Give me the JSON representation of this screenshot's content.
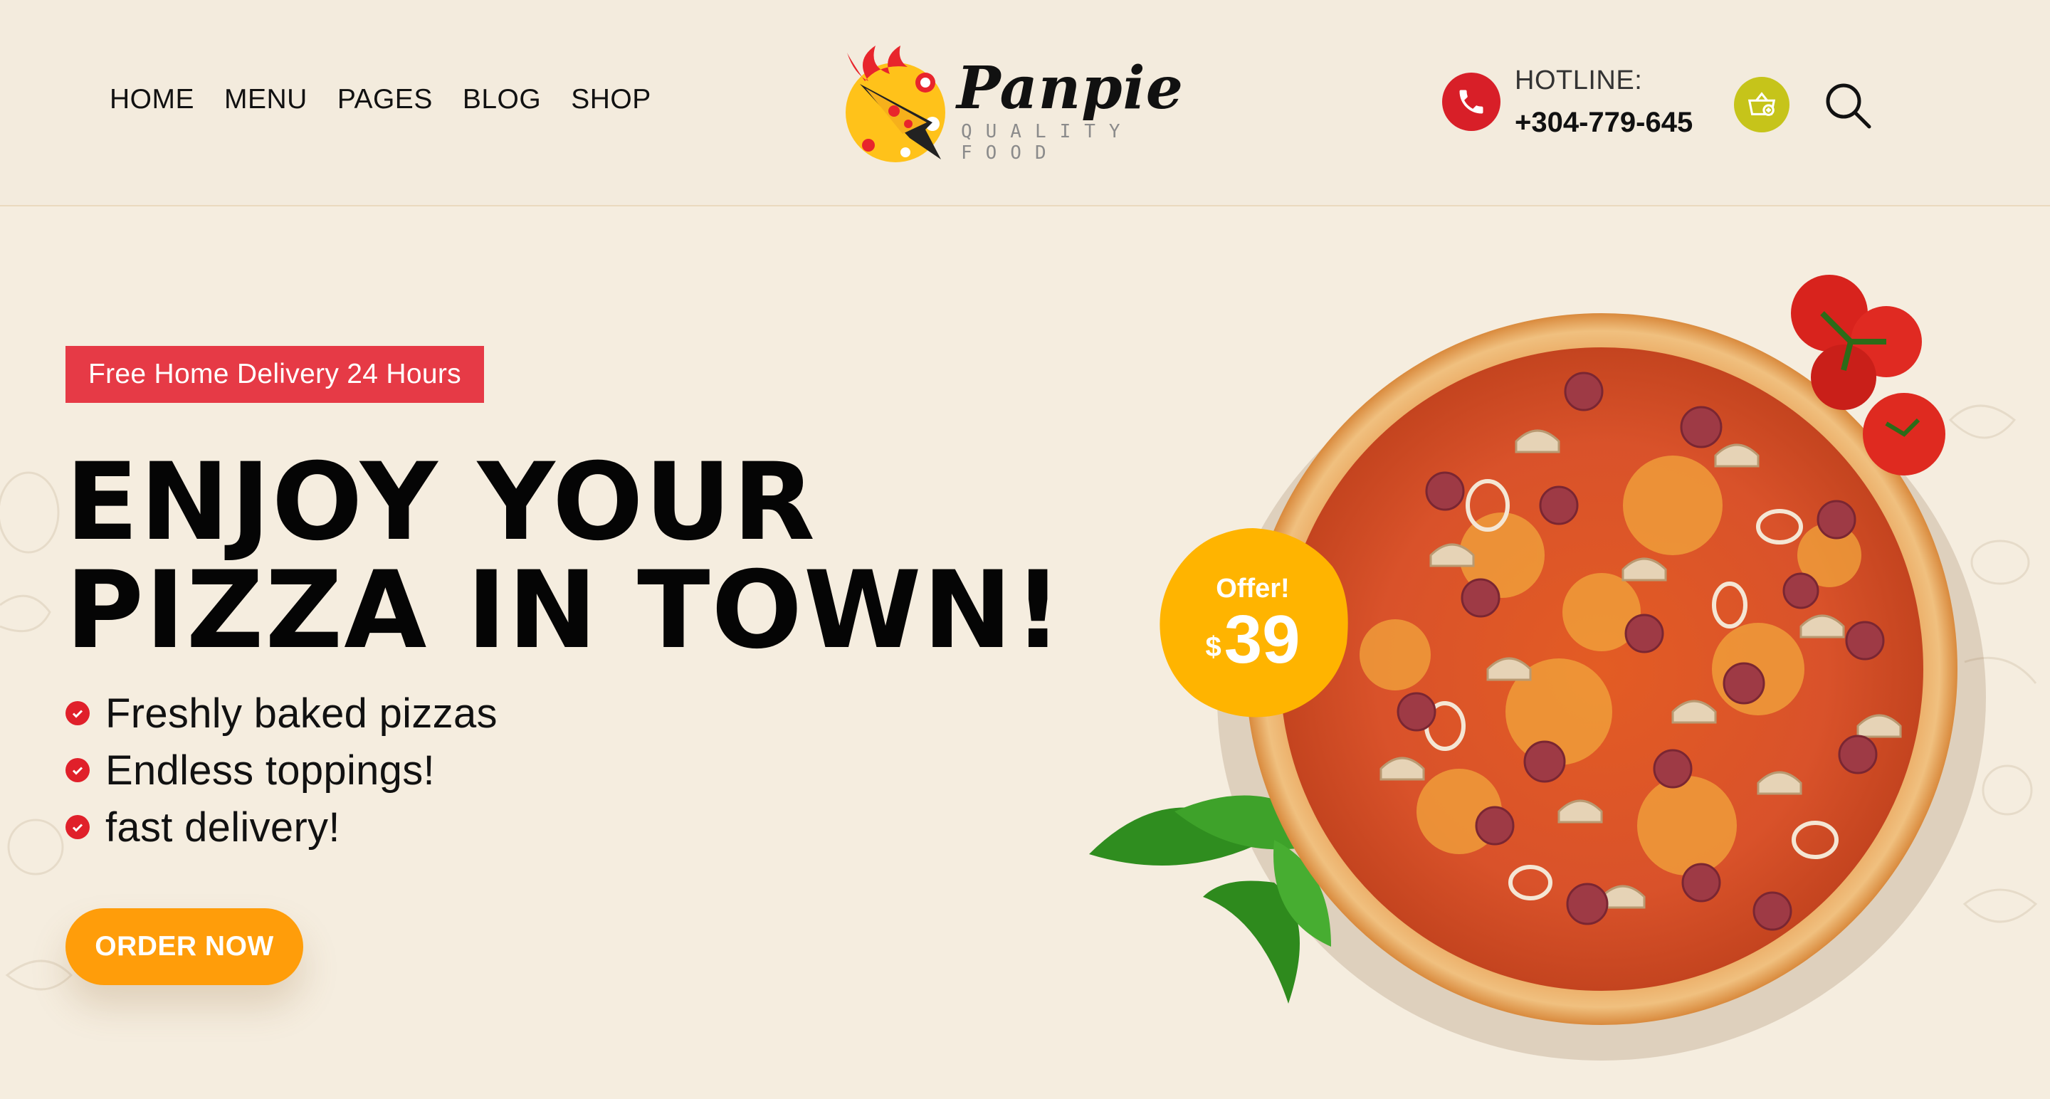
{
  "header": {
    "nav": [
      "HOME",
      "MENU",
      "PAGES",
      "BLOG",
      "SHOP"
    ],
    "logo": {
      "name": "Panpie",
      "tagline": "QUALITY FOOD"
    },
    "hotline": {
      "label": "HOTLINE:",
      "number": "+304-779-645"
    },
    "icons": {
      "phone": "phone-icon",
      "cart": "basket-icon",
      "search": "search-icon"
    }
  },
  "hero": {
    "badge": "Free Home Delivery 24 Hours",
    "headline_line1": "ENJOY YOUR",
    "headline_line2": "PIZZA IN TOWN!",
    "features": [
      "Freshly baked pizzas",
      "Endless toppings!",
      "fast delivery!"
    ],
    "cta": "ORDER NOW",
    "offer": {
      "label": "Offer!",
      "currency": "$",
      "price": "39"
    }
  },
  "colors": {
    "background": "#f5eddf",
    "badge": "#e63a46",
    "cta": "#ff9d0a",
    "phone": "#d81f28",
    "cart": "#c6c41a",
    "offer": "#ffb400"
  }
}
